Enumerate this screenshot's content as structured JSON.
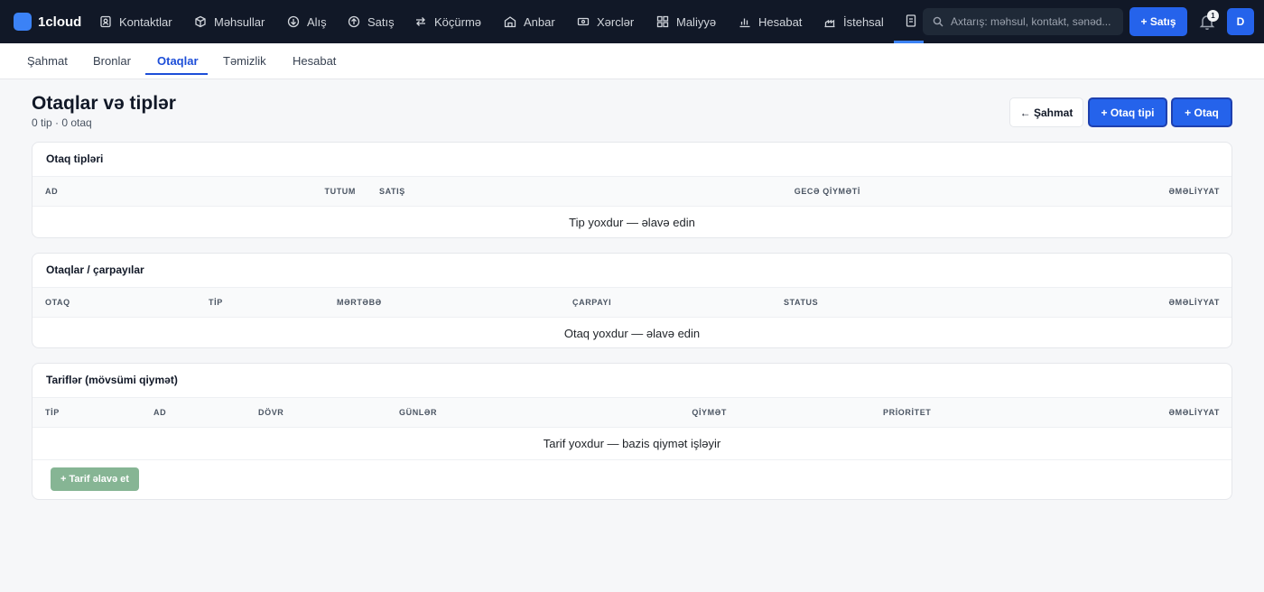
{
  "brand": {
    "name": "1cloud"
  },
  "nav": {
    "items": [
      {
        "label": "Kontaktlar"
      },
      {
        "label": "Məhsullar"
      },
      {
        "label": "Alış"
      },
      {
        "label": "Satış"
      },
      {
        "label": "Köçürmə"
      },
      {
        "label": "Anbar"
      },
      {
        "label": "Xərclər"
      },
      {
        "label": "Maliyyə"
      },
      {
        "label": "Hesabat"
      },
      {
        "label": "İstehsal"
      }
    ]
  },
  "search": {
    "placeholder": "Axtarış: məhsul, kontakt, sənəd..."
  },
  "top_actions": {
    "new_sale": "+ Satış",
    "notification_count": "1",
    "avatar_letter": "D"
  },
  "subnav": {
    "tabs": [
      {
        "label": "Şahmat"
      },
      {
        "label": "Bronlar"
      },
      {
        "label": "Otaqlar"
      },
      {
        "label": "Təmizlik"
      },
      {
        "label": "Hesabat"
      }
    ],
    "active": "Otaqlar"
  },
  "header": {
    "title": "Otaqlar və tiplər",
    "subtitle": "0 tip · 0 otaq",
    "back_button": "← Şahmat",
    "add_room_type_button": "+ Otaq tipi",
    "add_room_button": "+ Otaq"
  },
  "room_types": {
    "title": "Otaq tipləri",
    "columns": [
      "AD",
      "TUTUM",
      "SATIŞ",
      "GECƏ QİYMƏTİ",
      "ƏMƏLİYYAT"
    ],
    "empty_text": "Tip yoxdur — əlavə edin"
  },
  "rooms": {
    "title": "Otaqlar / çarpayılar",
    "columns": [
      "OTAQ",
      "TİP",
      "MƏRTƏBƏ",
      "ÇARPAYI",
      "STATUS",
      "ƏMƏLİYYAT"
    ],
    "empty_text": "Otaq yoxdur — əlavə edin"
  },
  "tariffs": {
    "title": "Tariflər (mövsümi qiymət)",
    "columns": [
      "TİP",
      "AD",
      "DÖVR",
      "GÜNLƏR",
      "QİYMƏT",
      "PRİORİTET",
      "ƏMƏLİYYAT"
    ],
    "empty_text": "Tarif yoxdur — bazis qiymət işləyir",
    "add_button": "+ Tarif əlavə et"
  },
  "colors": {
    "topbar_bg": "#111827",
    "accent": "#2563eb",
    "add_tariff_bg": "#86b594",
    "page_bg": "#f6f7f9"
  }
}
